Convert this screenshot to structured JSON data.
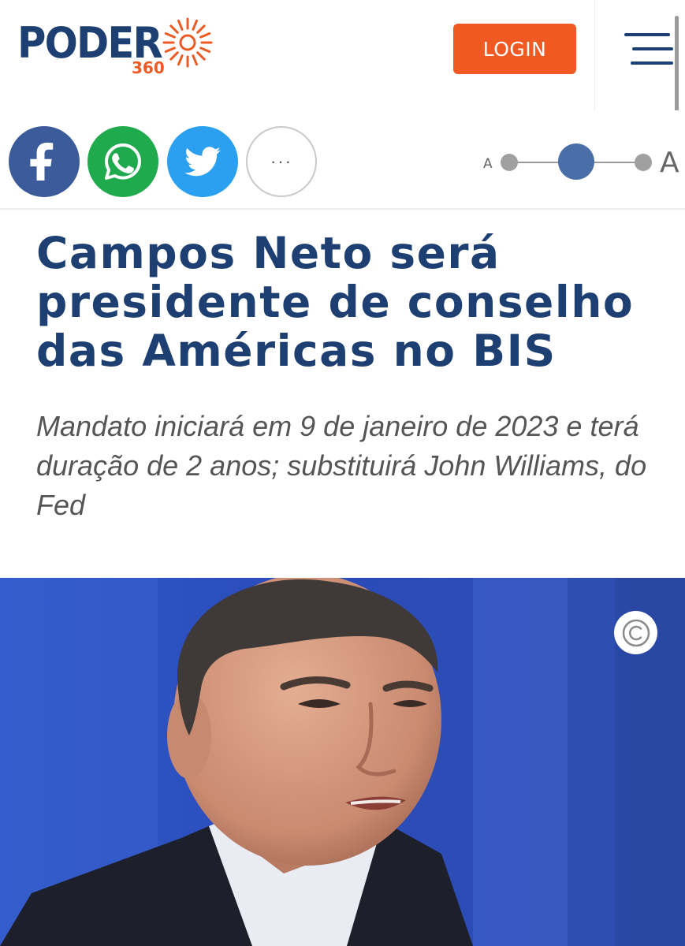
{
  "header": {
    "logo_word": "PODER",
    "logo_number": "360",
    "login_label": "LOGIN"
  },
  "share": {
    "more_label": "···"
  },
  "font_size_control": {
    "small_label": "A",
    "large_label": "A"
  },
  "article": {
    "headline": "Campos Neto será presidente de conselho das Américas no BIS",
    "subtitle": "Mandato iniciará em 9 de janeiro de 2023 e terá duração de 2 anos; substituirá John Williams, do Fed"
  },
  "colors": {
    "brand_blue": "#1d3f72",
    "brand_orange": "#f05a22",
    "facebook": "#3b5b9a",
    "whatsapp": "#1eaa4d",
    "twitter": "#2b9ff0"
  },
  "icons": {
    "menu": "hamburger-icon",
    "facebook": "facebook-icon",
    "whatsapp": "whatsapp-icon",
    "twitter": "twitter-icon",
    "more": "more-icon",
    "copyright": "copyright-icon"
  }
}
